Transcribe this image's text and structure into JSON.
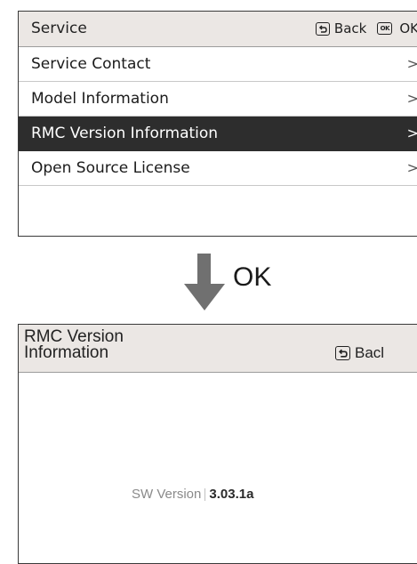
{
  "service_screen": {
    "title": "Service",
    "back_label": "Back",
    "ok_icon_text": "OK",
    "ok_label": "OK",
    "items": [
      {
        "label": "Service Contact",
        "selected": false
      },
      {
        "label": "Model Information",
        "selected": false
      },
      {
        "label": "RMC Version Information",
        "selected": true
      },
      {
        "label": "Open Source License",
        "selected": false
      }
    ],
    "chevron": ">"
  },
  "transition": {
    "label": "OK"
  },
  "version_screen": {
    "title_line1": "RMC Version",
    "title_line2": "Information",
    "back_label": "Bacl",
    "sw_version_label": "SW Version",
    "sw_version_value": "3.03.1a"
  }
}
